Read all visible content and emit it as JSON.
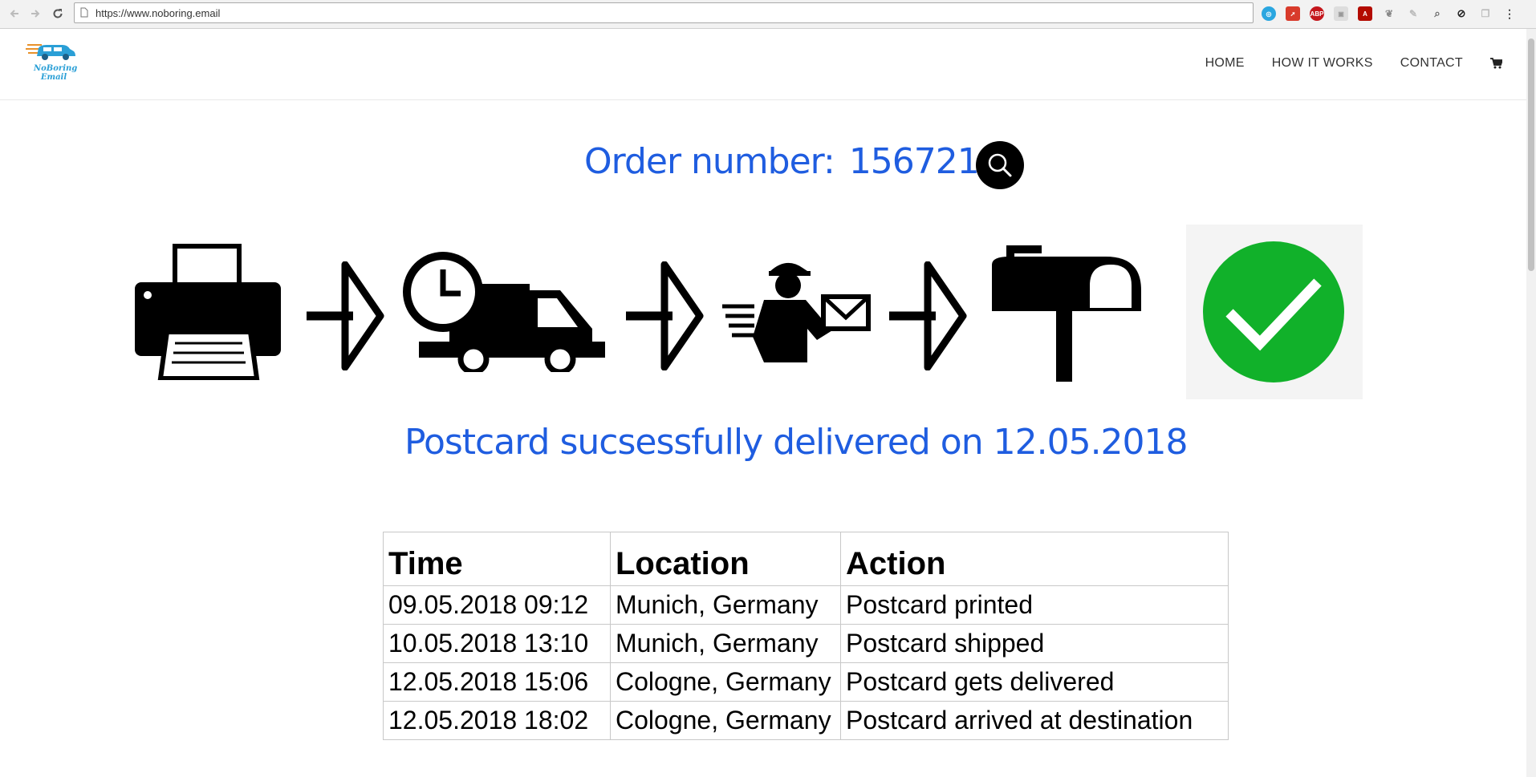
{
  "browser": {
    "url": "https://www.noboring.email"
  },
  "site": {
    "logo_line1": "NoBoring",
    "logo_line2": "Email",
    "nav": [
      {
        "label": "HOME"
      },
      {
        "label": "HOW IT WORKS"
      },
      {
        "label": "CONTACT"
      }
    ]
  },
  "order": {
    "label": "Order number:",
    "number": "156721"
  },
  "stages": [
    "printer-icon",
    "delivery-truck-icon",
    "courier-icon",
    "mailbox-icon",
    "checkmark-icon"
  ],
  "status": "Postcard sucsessfully delivered on 12.05.2018",
  "table": {
    "headers": [
      "Time",
      "Location",
      "Action"
    ],
    "rows": [
      [
        "09.05.2018 09:12",
        "Munich, Germany",
        "Postcard printed"
      ],
      [
        "10.05.2018 13:10",
        "Munich, Germany",
        "Postcard shipped"
      ],
      [
        "12.05.2018 15:06",
        "Cologne, Germany",
        "Postcard gets delivered"
      ],
      [
        "12.05.2018 18:02",
        "Cologne, Germany",
        "Postcard arrived at destination"
      ]
    ]
  },
  "colors": {
    "accent_blue": "#1f5de0",
    "check_green": "#11b12a"
  }
}
